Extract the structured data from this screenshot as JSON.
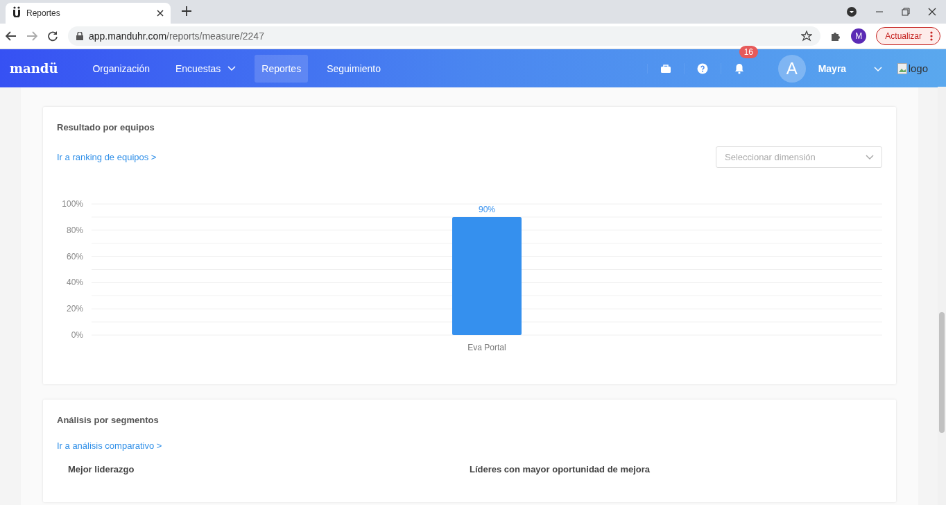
{
  "browser": {
    "tab_title": "Reportes",
    "url_host": "app.manduhr.com",
    "url_path": "/reports/measure/2247",
    "profile_letter": "M",
    "update_button": "Actualizar"
  },
  "navbar": {
    "brand": "mandü",
    "items": [
      {
        "label": "Organización",
        "selected": false,
        "dropdown": false
      },
      {
        "label": "Encuestas",
        "selected": false,
        "dropdown": true
      },
      {
        "label": "Reportes",
        "selected": true,
        "dropdown": false
      },
      {
        "label": "Seguimiento",
        "selected": false,
        "dropdown": false
      }
    ],
    "notification_count": "16",
    "avatar_letter": "A",
    "user_name": "Mayra",
    "logo_alt": "logo"
  },
  "team_results": {
    "title": "Resultado por equipos",
    "link": "Ir a ranking de equipos >",
    "dimension_select": {
      "placeholder": "Seleccionar dimensión"
    },
    "chart_data": {
      "type": "bar",
      "categories": [
        "Eva Portal"
      ],
      "grid": true,
      "series": [
        {
          "color": "#3590ee",
          "values": [
            90
          ]
        }
      ],
      "ylim": [
        0,
        100
      ],
      "yticks": [
        {
          "value": 0,
          "label": "0%"
        },
        {
          "value": 20,
          "label": "20%"
        },
        {
          "value": 40,
          "label": "40%"
        },
        {
          "value": 60,
          "label": "60%"
        },
        {
          "value": 80,
          "label": "80%"
        },
        {
          "value": 100,
          "label": "100%"
        }
      ],
      "value_labels": [
        "90%"
      ]
    }
  },
  "segment_analysis": {
    "title": "Análisis por segmentos",
    "link": "Ir a análisis comparativo >",
    "columns": [
      "Mejor liderazgo",
      "Líderes con mayor oportunidad de mejora"
    ]
  }
}
